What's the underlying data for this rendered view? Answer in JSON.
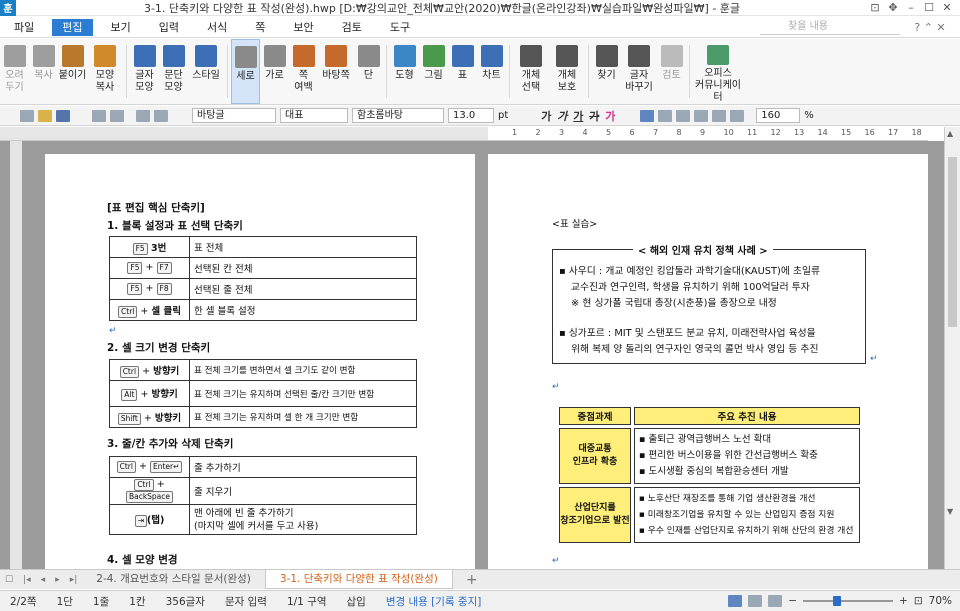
{
  "window": {
    "title": "3-1. 단축키와 다양한 표 작성(완성).hwp [D:₩강의교안_전체₩교안(2020)₩한글(온라인강좌)₩실습파일₩완성파일₩] - 훈글",
    "app_icon": "훈",
    "btn_pin": "⊡",
    "btn_move": "✥",
    "btn_min": "–",
    "btn_max": "☐",
    "btn_close": "✕"
  },
  "menu": {
    "items": [
      "파일",
      "편집",
      "보기",
      "입력",
      "서식",
      "쪽",
      "보안",
      "검토",
      "도구"
    ],
    "active_index": 1,
    "search_placeholder": "찾을 내용",
    "extra": "? ⌃ ✕"
  },
  "ribbon": {
    "groups": [
      {
        "label": "오려\n두기",
        "icon": "scissors-icon",
        "disabled": true,
        "color": "#9e9e9e"
      },
      {
        "label": "복사",
        "icon": "copy-icon",
        "disabled": true,
        "color": "#9e9e9e"
      },
      {
        "label": "붙이기",
        "icon": "paste-icon",
        "disabled": false,
        "color": "#b8792c"
      },
      {
        "label": "모양\n복사",
        "icon": "format-copy-icon",
        "disabled": false,
        "color": "#d08a2c"
      },
      {
        "label": "글자\n모양",
        "icon": "char-shape-icon",
        "disabled": false,
        "color": "#3d6fb6"
      },
      {
        "label": "문단\n모양",
        "icon": "para-shape-icon",
        "disabled": false,
        "color": "#3d6fb6"
      },
      {
        "label": "스타일",
        "icon": "style-icon",
        "disabled": false,
        "color": "#3d6fb6"
      },
      {
        "label": "세로",
        "icon": "portrait-icon",
        "disabled": false,
        "selected": true,
        "color": "#8a8a8a"
      },
      {
        "label": "가로",
        "icon": "landscape-icon",
        "disabled": false,
        "color": "#8a8a8a"
      },
      {
        "label": "쪽\n여백",
        "icon": "margin-icon",
        "disabled": false,
        "color": "#c66a2b"
      },
      {
        "label": "바탕쪽",
        "icon": "master-page-icon",
        "disabled": false,
        "color": "#c66a2b"
      },
      {
        "label": "단",
        "icon": "columns-icon",
        "disabled": false,
        "color": "#8a8a8a"
      },
      {
        "label": "도형",
        "icon": "shape-icon",
        "disabled": false,
        "color": "#3d86c6"
      },
      {
        "label": "그림",
        "icon": "picture-icon",
        "disabled": false,
        "color": "#4b9a4b"
      },
      {
        "label": "표",
        "icon": "table-icon",
        "disabled": false,
        "color": "#3d6fb6"
      },
      {
        "label": "차트",
        "icon": "chart-icon",
        "disabled": false,
        "color": "#3d6fb6"
      },
      {
        "label": "개체\n선택",
        "icon": "object-select-icon",
        "disabled": false,
        "color": "#555555"
      },
      {
        "label": "개체\n보호",
        "icon": "object-protect-icon",
        "disabled": false,
        "color": "#555555"
      },
      {
        "label": "찾기",
        "icon": "find-icon",
        "disabled": false,
        "color": "#555555"
      },
      {
        "label": "글자\n바꾸기",
        "icon": "replace-icon",
        "disabled": false,
        "color": "#555555"
      },
      {
        "label": "검토",
        "icon": "review-icon",
        "disabled": true,
        "color": "#bbbbbb"
      },
      {
        "label": "오피스\n커뮤니케이터",
        "icon": "office-communicator-icon",
        "disabled": false,
        "color": "#4a9a6a"
      }
    ]
  },
  "toolbar": {
    "style": "바탕글",
    "lang": "대표",
    "font": "함초롬바탕",
    "size": "13.0",
    "size_unit": "pt",
    "fmt_bold": "가",
    "fmt_italic": "가",
    "fmt_under": "가",
    "fmt_strike": "가",
    "fmt_color": "가",
    "zoom": "160",
    "zoom_unit": "%"
  },
  "ruler": {
    "ticks": [
      "1",
      "2",
      "3",
      "4",
      "5",
      "6",
      "7",
      "8",
      "9",
      "10",
      "11",
      "12",
      "13",
      "14",
      "15",
      "16",
      "17",
      "18"
    ]
  },
  "page1": {
    "title": "[표 편집 핵심 단축키]",
    "s1_title": "1. 블록 설정과 표 선택 단축키",
    "t1": [
      {
        "k1": "F5",
        "extra": " 3번",
        "desc": "표 전체"
      },
      {
        "k1": "F5",
        "plus": "+",
        "k2": "F7",
        "desc": "선택된 칸 전체"
      },
      {
        "k1": "F5",
        "plus": "+",
        "k2": "F8",
        "desc": "선택된 줄 전체"
      },
      {
        "k1": "Ctrl",
        "plus": "+",
        "k2t": "셀 클릭",
        "desc": "한 셀 블록 설정"
      }
    ],
    "s2_title": "2. 셀 크기 변경 단축키",
    "t2": [
      {
        "k1": "Ctrl",
        "plus": "+",
        "k2t": "방향키",
        "desc": "표 전체 크기를 변하면서 셀 크기도 같이 변함"
      },
      {
        "k1": "Alt",
        "plus": "+",
        "k2t": "방향키",
        "desc": "표 전체 크기는 유지하며 선택된 줄/칸 크기만 변함"
      },
      {
        "k1": "Shift",
        "plus": "+",
        "k2t": "방향키",
        "desc": "표 전체 크기는 유지하며 셀 한 개 크기만 변함"
      }
    ],
    "s3_title": "3. 줄/칸 추가와 삭제 단축키",
    "t3": [
      {
        "k1": "Ctrl",
        "plus": "+",
        "k2": "Enter↵",
        "desc": "줄 추가하기"
      },
      {
        "k1": "Ctrl",
        "plus": "+",
        "k2": "BackSpace",
        "desc": "줄 지우기"
      },
      {
        "k1": "⇥",
        "k2t": "(탭)",
        "desc": "맨 아래에 빈 줄 추가하기",
        "desc2": "(마지막 셀에 커서를 두고 사용)"
      }
    ],
    "s4_title": "4. 셀 모양 변경"
  },
  "page2": {
    "label": "<표 실습>",
    "box_caption": "< 해외 인재 유치 정책 사례 >",
    "bullets": [
      {
        "text": "▪ 사우디 : 개교 예정인 킹압둘라 과학기술대(KAUST)에 초일류",
        "l2": "교수진과 연구인력, 학생을 유치하기 위해 100억달러 투자",
        "l3": "※ 현 싱가폴 국립대 총장(시춘풍)을 총장으로 내정"
      },
      {
        "text": "▪ 싱가포르 : MIT 및 스탠포드 분교 유치, 미래전략사업 육성을",
        "l2": "위해 복제 양 돌리의 연구자인 영국의 콜먼 박사 영입 등 추진"
      }
    ],
    "table_headers": [
      "중점과제",
      "주요 추진 내용"
    ],
    "table_rows": [
      {
        "label1": "대중교통",
        "label2": "인프라 확충",
        "items": [
          "▪ 출퇴근 광역급행버스 노선 확대",
          "▪ 편리한 버스이용을 위한 간선급행버스 확충",
          "▪ 도시생활 중심의 복합환승센터 개발"
        ]
      },
      {
        "label1": "산업단지를",
        "label2": "창조기업으로 발전",
        "items": [
          "▪ 노후산단 재장조를 통해 기업 생산환경을 개선",
          "▪ 미래창조기업을 유치할 수 있는 산업입지 증점 지원",
          "▪ 우수 인재를 산업단지로 유치하기 위해 산단의 환경 개선"
        ]
      }
    ]
  },
  "tabs": {
    "items": [
      "2-4. 개요번호와 스타일 문서(완성)",
      "3-1. 단축키와 다양한 표 작성(완성)"
    ],
    "active_index": 1,
    "add": "+"
  },
  "status": {
    "page": "2/2쪽",
    "section": "1단",
    "line": "1줄",
    "col": "1칸",
    "chars": "356글자",
    "input": "문자 입력",
    "area": "1/1 구역",
    "mode": "삽입",
    "track": "변경 내용 [기록 중지]",
    "zoom": "70%"
  },
  "colors": {
    "accent": "#2b7cd3",
    "highlight_yellow": "#ffef7a",
    "active_tab": "#d2611a",
    "mark_blue": "#2a6cc9"
  }
}
